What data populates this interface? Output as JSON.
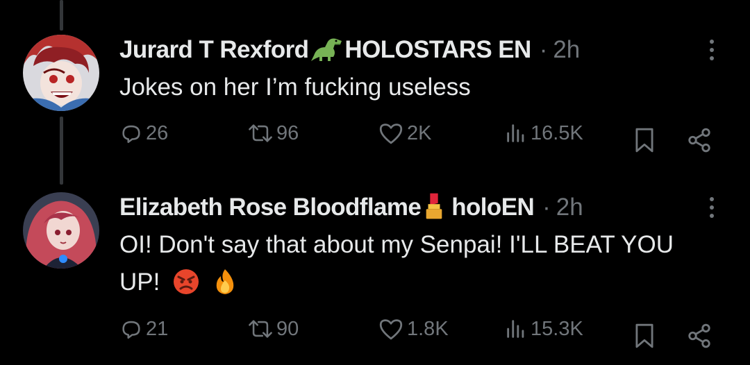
{
  "tweets": [
    {
      "author": "Jurard T Rexford",
      "affiliation": "HOLOSTARS EN",
      "emoji": "dinosaur-emoji",
      "separator": "·",
      "time": "2h",
      "text": "Jokes on her I’m fucking useless",
      "replies": "26",
      "retweets": "96",
      "likes": "2K",
      "views": "16.5K",
      "avatar_colors": {
        "hair": "#b5312f",
        "bg": "#d9d9de",
        "skin": "#f3e3dc"
      }
    },
    {
      "author": "Elizabeth Rose Bloodflame",
      "affiliation": "holoEN",
      "emoji": "lipstick-emoji",
      "separator": "·",
      "time": "2h",
      "text": "OI! Don't say that about my Senpai! I'LL BEAT YOU UP!",
      "text_emojis": [
        "angry-face-emoji",
        "fire-emoji"
      ],
      "replies": "21",
      "retweets": "90",
      "likes": "1.8K",
      "views": "15.3K",
      "avatar_colors": {
        "hair": "#c44a5a",
        "bg": "#3a3f52",
        "skin": "#f1d7d2"
      }
    }
  ],
  "colors": {
    "background": "#000000",
    "primary_text": "#e7e9ea",
    "secondary_text": "#71767b",
    "thread_line": "#333639"
  }
}
